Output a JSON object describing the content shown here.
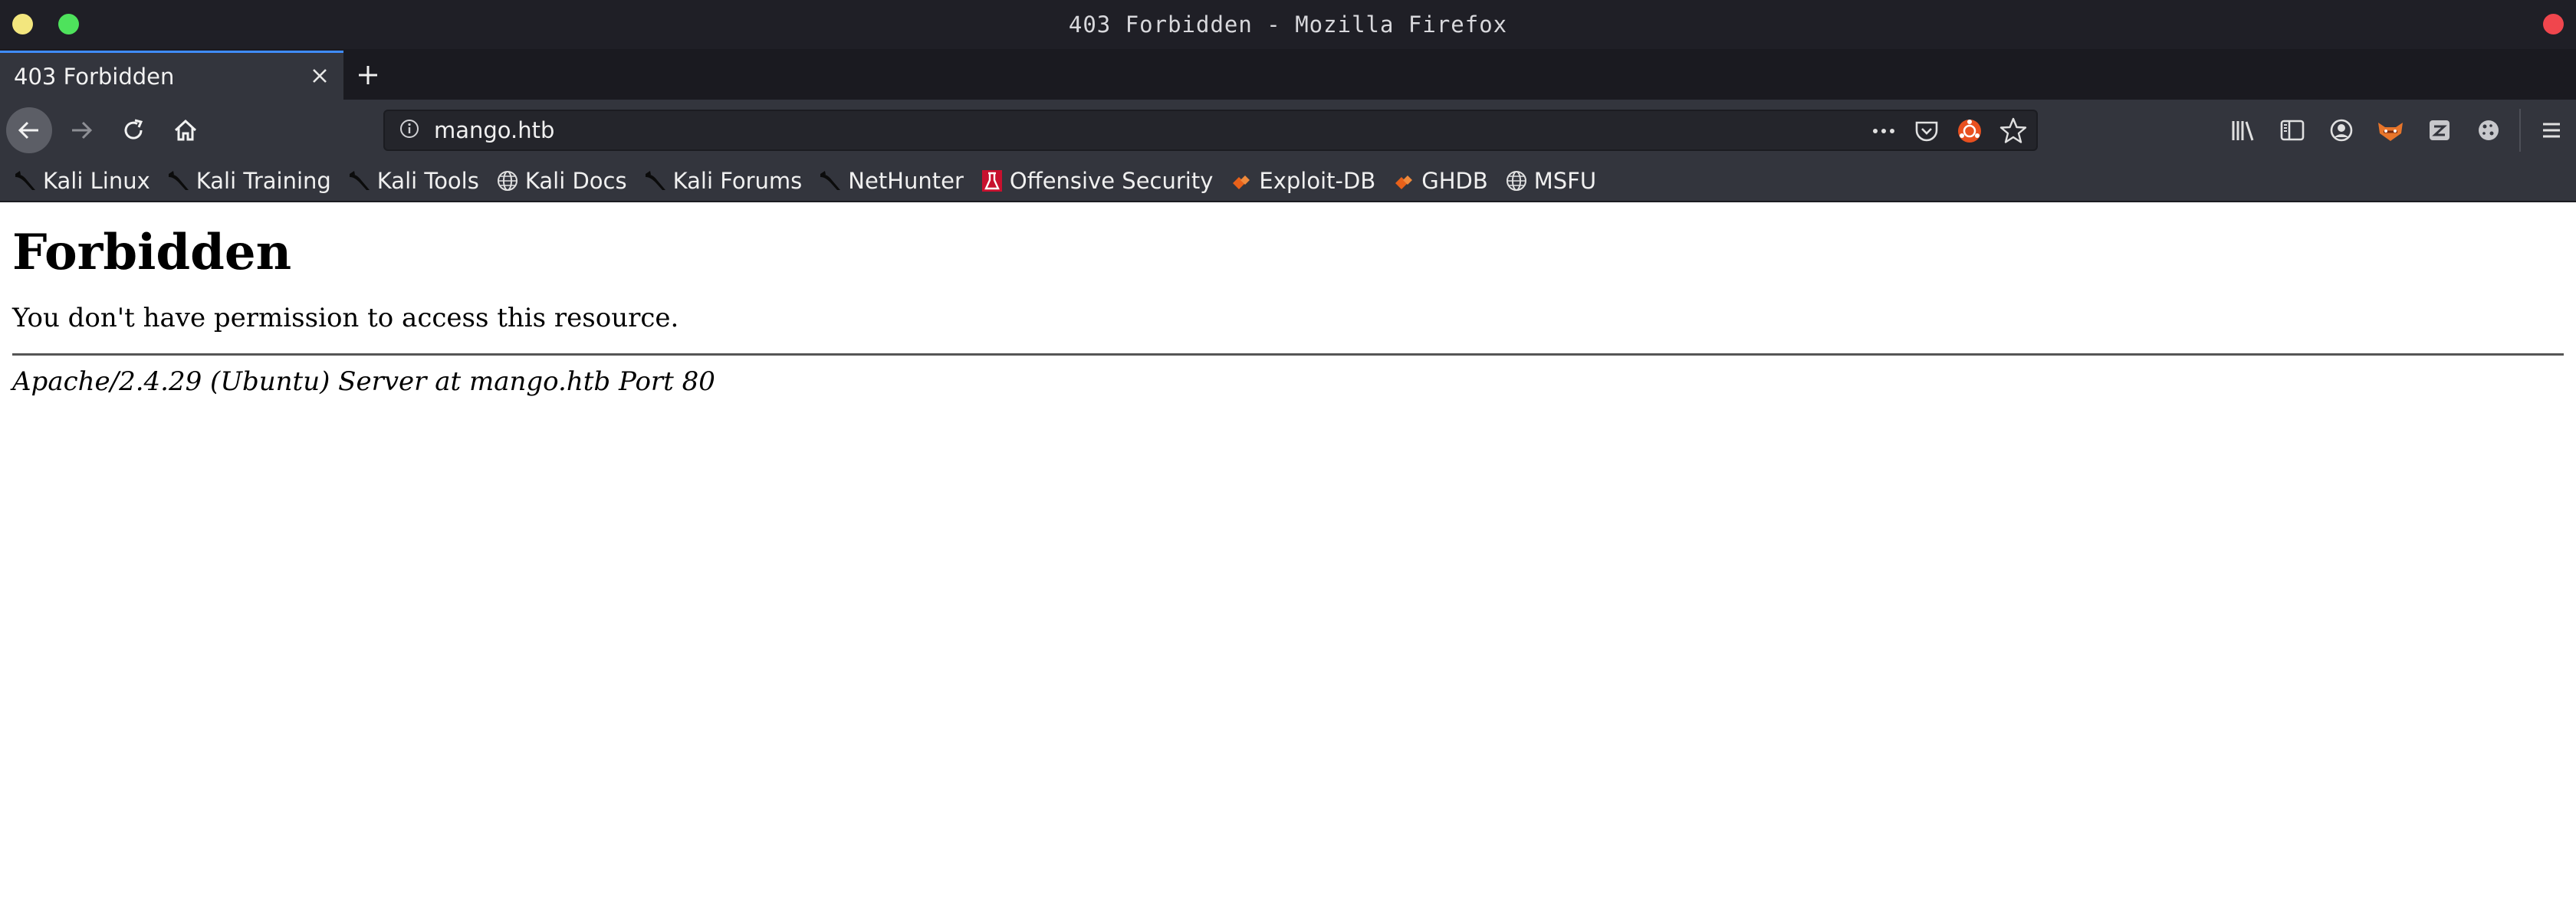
{
  "window": {
    "title": "403 Forbidden - Mozilla Firefox",
    "controls": {
      "minimize_color": "#f3e67e",
      "maximize_color": "#4ee25c",
      "close_color": "#f0464d"
    }
  },
  "tabs": [
    {
      "label": "403 Forbidden",
      "active": true
    }
  ],
  "navbar": {
    "url": "mango.htb",
    "icons": [
      "back-icon",
      "forward-icon",
      "reload-icon",
      "home-icon",
      "info-icon",
      "more-icon",
      "pocket-icon",
      "ublock-icon",
      "bookmark-star-icon"
    ],
    "toolbar_icons": [
      "library-icon",
      "sidebar-icon",
      "account-icon",
      "foxyproxy-icon",
      "extension-icon",
      "cookie-icon",
      "menu-icon"
    ]
  },
  "bookmarks": [
    {
      "label": "Kali Linux",
      "icon": "kali-dragon-icon"
    },
    {
      "label": "Kali Training",
      "icon": "kali-dragon-icon"
    },
    {
      "label": "Kali Tools",
      "icon": "kali-dragon-icon"
    },
    {
      "label": "Kali Docs",
      "icon": "globe-icon"
    },
    {
      "label": "Kali Forums",
      "icon": "kali-dragon-icon"
    },
    {
      "label": "NetHunter",
      "icon": "kali-dragon-icon"
    },
    {
      "label": "Offensive Security",
      "icon": "offsec-icon"
    },
    {
      "label": "Exploit-DB",
      "icon": "exploitdb-icon"
    },
    {
      "label": "GHDB",
      "icon": "exploitdb-icon"
    },
    {
      "label": "MSFU",
      "icon": "globe-icon"
    }
  ],
  "page": {
    "heading": "Forbidden",
    "message": "You don't have permission to access this resource.",
    "server_signature": "Apache/2.4.29 (Ubuntu) Server at mango.htb Port 80"
  }
}
